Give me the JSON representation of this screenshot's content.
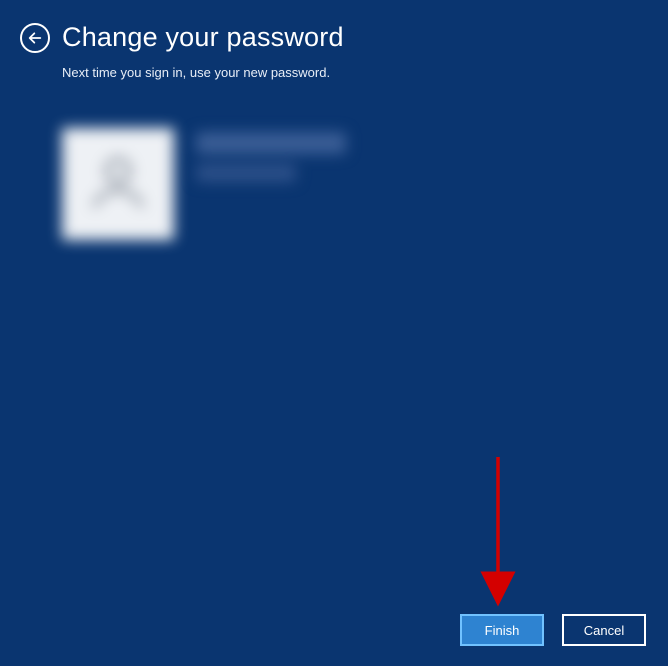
{
  "header": {
    "title": "Change your password",
    "subtitle": "Next time you sign in, use your new password."
  },
  "buttons": {
    "finish": "Finish",
    "cancel": "Cancel"
  },
  "colors": {
    "background": "#0a3570",
    "primary_button_bg": "#2e83d1",
    "primary_button_border": "#71c2ff",
    "annotation_arrow": "#d40000"
  }
}
